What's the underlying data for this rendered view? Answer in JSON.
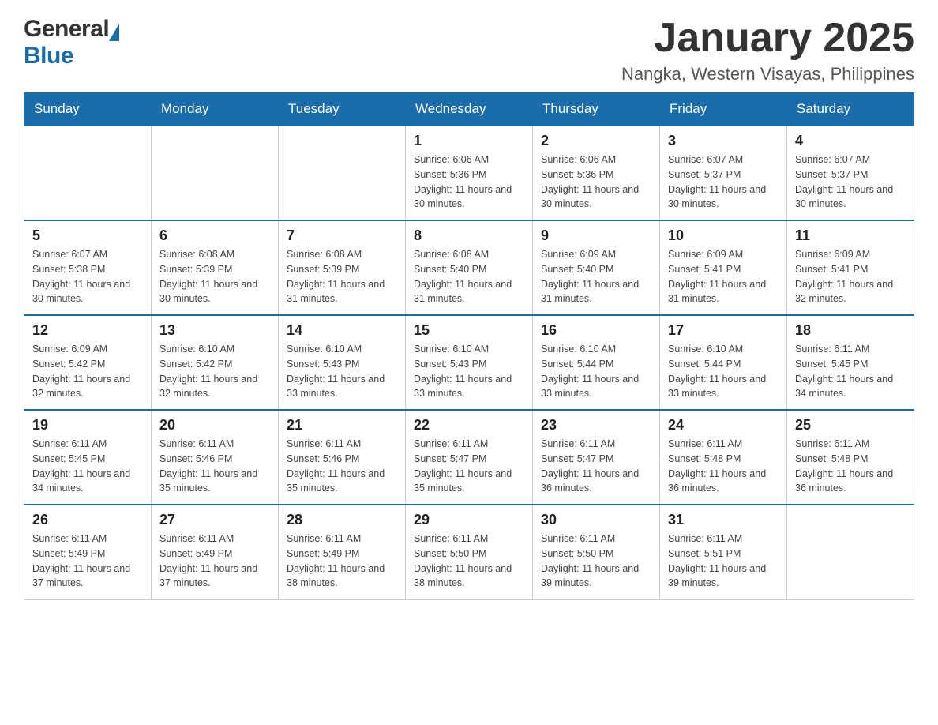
{
  "header": {
    "logo": {
      "general": "General",
      "blue": "Blue"
    },
    "title": "January 2025",
    "subtitle": "Nangka, Western Visayas, Philippines"
  },
  "days_of_week": [
    "Sunday",
    "Monday",
    "Tuesday",
    "Wednesday",
    "Thursday",
    "Friday",
    "Saturday"
  ],
  "weeks": [
    [
      {
        "day": "",
        "info": ""
      },
      {
        "day": "",
        "info": ""
      },
      {
        "day": "",
        "info": ""
      },
      {
        "day": "1",
        "info": "Sunrise: 6:06 AM\nSunset: 5:36 PM\nDaylight: 11 hours and 30 minutes."
      },
      {
        "day": "2",
        "info": "Sunrise: 6:06 AM\nSunset: 5:36 PM\nDaylight: 11 hours and 30 minutes."
      },
      {
        "day": "3",
        "info": "Sunrise: 6:07 AM\nSunset: 5:37 PM\nDaylight: 11 hours and 30 minutes."
      },
      {
        "day": "4",
        "info": "Sunrise: 6:07 AM\nSunset: 5:37 PM\nDaylight: 11 hours and 30 minutes."
      }
    ],
    [
      {
        "day": "5",
        "info": "Sunrise: 6:07 AM\nSunset: 5:38 PM\nDaylight: 11 hours and 30 minutes."
      },
      {
        "day": "6",
        "info": "Sunrise: 6:08 AM\nSunset: 5:39 PM\nDaylight: 11 hours and 30 minutes."
      },
      {
        "day": "7",
        "info": "Sunrise: 6:08 AM\nSunset: 5:39 PM\nDaylight: 11 hours and 31 minutes."
      },
      {
        "day": "8",
        "info": "Sunrise: 6:08 AM\nSunset: 5:40 PM\nDaylight: 11 hours and 31 minutes."
      },
      {
        "day": "9",
        "info": "Sunrise: 6:09 AM\nSunset: 5:40 PM\nDaylight: 11 hours and 31 minutes."
      },
      {
        "day": "10",
        "info": "Sunrise: 6:09 AM\nSunset: 5:41 PM\nDaylight: 11 hours and 31 minutes."
      },
      {
        "day": "11",
        "info": "Sunrise: 6:09 AM\nSunset: 5:41 PM\nDaylight: 11 hours and 32 minutes."
      }
    ],
    [
      {
        "day": "12",
        "info": "Sunrise: 6:09 AM\nSunset: 5:42 PM\nDaylight: 11 hours and 32 minutes."
      },
      {
        "day": "13",
        "info": "Sunrise: 6:10 AM\nSunset: 5:42 PM\nDaylight: 11 hours and 32 minutes."
      },
      {
        "day": "14",
        "info": "Sunrise: 6:10 AM\nSunset: 5:43 PM\nDaylight: 11 hours and 33 minutes."
      },
      {
        "day": "15",
        "info": "Sunrise: 6:10 AM\nSunset: 5:43 PM\nDaylight: 11 hours and 33 minutes."
      },
      {
        "day": "16",
        "info": "Sunrise: 6:10 AM\nSunset: 5:44 PM\nDaylight: 11 hours and 33 minutes."
      },
      {
        "day": "17",
        "info": "Sunrise: 6:10 AM\nSunset: 5:44 PM\nDaylight: 11 hours and 33 minutes."
      },
      {
        "day": "18",
        "info": "Sunrise: 6:11 AM\nSunset: 5:45 PM\nDaylight: 11 hours and 34 minutes."
      }
    ],
    [
      {
        "day": "19",
        "info": "Sunrise: 6:11 AM\nSunset: 5:45 PM\nDaylight: 11 hours and 34 minutes."
      },
      {
        "day": "20",
        "info": "Sunrise: 6:11 AM\nSunset: 5:46 PM\nDaylight: 11 hours and 35 minutes."
      },
      {
        "day": "21",
        "info": "Sunrise: 6:11 AM\nSunset: 5:46 PM\nDaylight: 11 hours and 35 minutes."
      },
      {
        "day": "22",
        "info": "Sunrise: 6:11 AM\nSunset: 5:47 PM\nDaylight: 11 hours and 35 minutes."
      },
      {
        "day": "23",
        "info": "Sunrise: 6:11 AM\nSunset: 5:47 PM\nDaylight: 11 hours and 36 minutes."
      },
      {
        "day": "24",
        "info": "Sunrise: 6:11 AM\nSunset: 5:48 PM\nDaylight: 11 hours and 36 minutes."
      },
      {
        "day": "25",
        "info": "Sunrise: 6:11 AM\nSunset: 5:48 PM\nDaylight: 11 hours and 36 minutes."
      }
    ],
    [
      {
        "day": "26",
        "info": "Sunrise: 6:11 AM\nSunset: 5:49 PM\nDaylight: 11 hours and 37 minutes."
      },
      {
        "day": "27",
        "info": "Sunrise: 6:11 AM\nSunset: 5:49 PM\nDaylight: 11 hours and 37 minutes."
      },
      {
        "day": "28",
        "info": "Sunrise: 6:11 AM\nSunset: 5:49 PM\nDaylight: 11 hours and 38 minutes."
      },
      {
        "day": "29",
        "info": "Sunrise: 6:11 AM\nSunset: 5:50 PM\nDaylight: 11 hours and 38 minutes."
      },
      {
        "day": "30",
        "info": "Sunrise: 6:11 AM\nSunset: 5:50 PM\nDaylight: 11 hours and 39 minutes."
      },
      {
        "day": "31",
        "info": "Sunrise: 6:11 AM\nSunset: 5:51 PM\nDaylight: 11 hours and 39 minutes."
      },
      {
        "day": "",
        "info": ""
      }
    ]
  ]
}
